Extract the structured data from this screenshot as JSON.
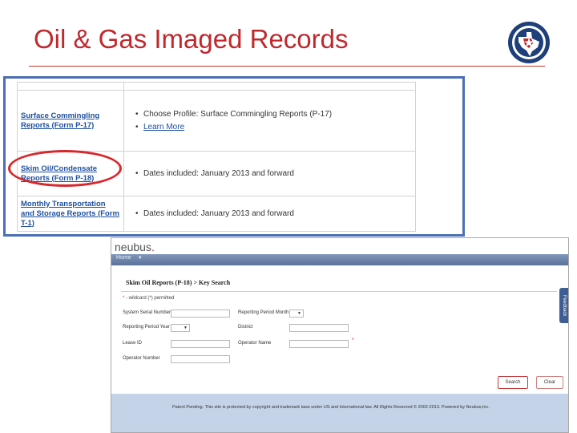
{
  "slide": {
    "title": "Oil & Gas Imaged Records"
  },
  "records_table": {
    "rows": [
      {
        "name": "Surface Commingling Reports (Form P-17)",
        "bullets": [
          "Choose Profile: Surface Commingling Reports (P-17)",
          "Learn More"
        ]
      },
      {
        "name": "Skim Oil/Condensate Reports (Form P-18)",
        "bullets": [
          "Dates included: January 2013 and forward"
        ]
      },
      {
        "name": "Monthly Transportation and Storage Reports (Form T-1)",
        "bullets": [
          "Dates included: January 2013 and forward"
        ]
      }
    ],
    "bullet_glyph": "•"
  },
  "neubus": {
    "logo": "neubus",
    "logo_dot": ".",
    "nav_home": "Home",
    "nav_caret": "▼",
    "feedback_label": "Feedback",
    "page_heading": "Skim Oil Reports (P-18) > Key Search",
    "required_star": "*",
    "required_note": "- wildcard (*) permitted",
    "fields": {
      "system_serial_number": "System Serial Number",
      "reporting_period_month": "Reporting Period Month",
      "reporting_period_year": "Reporting Period Year",
      "district": "District",
      "lease_id": "Lease ID",
      "operator_name": "Operator Name",
      "operator_number": "Operator Number"
    },
    "select_caret": "▼",
    "search_button": "Search",
    "clear_button": "Clear",
    "footer": "Patent Pending. This site is protected by copyright and trademark laws under US and International law. All Rights Reserved © 2002-2013. Powered by Neubus,Inc."
  }
}
